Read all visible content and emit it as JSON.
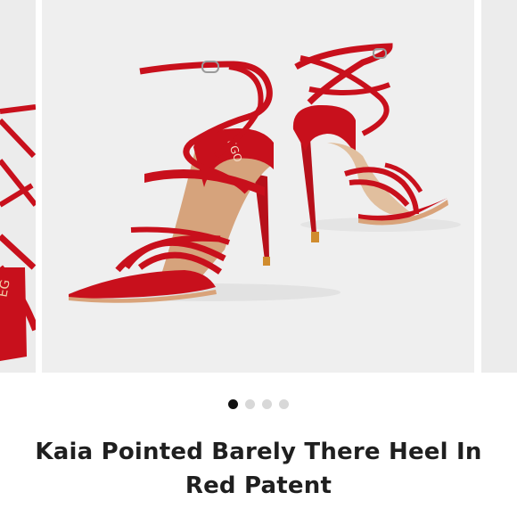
{
  "product": {
    "title": "Kaia Pointed Barely There Heel In Red Patent",
    "image_alt": "Red patent strappy pointed heels"
  },
  "carousel": {
    "slide_count": 4,
    "active_index": 0
  },
  "colors": {
    "patent_red": "#c8101c",
    "background": "#efefef",
    "dot_active": "#111111",
    "dot_inactive": "#d8d8d8"
  }
}
